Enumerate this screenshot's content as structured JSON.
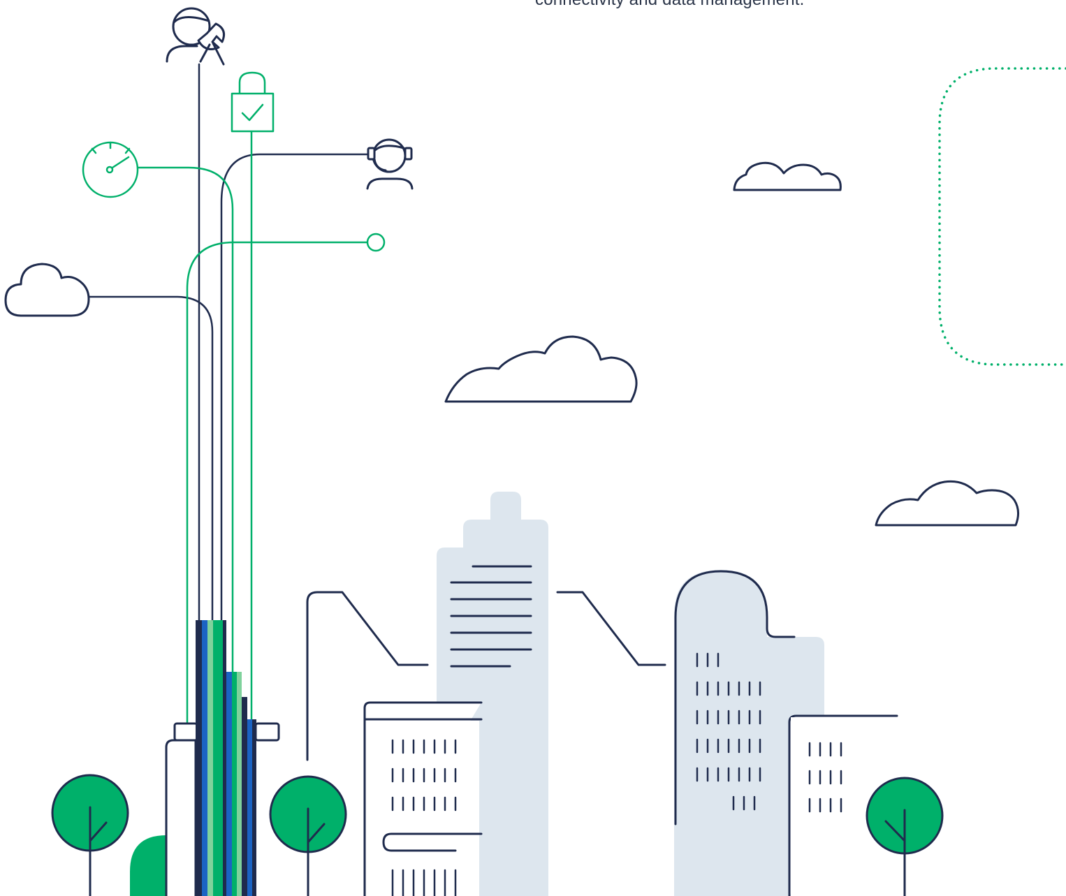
{
  "caption": {
    "text": "connectivity and data management."
  },
  "colors": {
    "navy": "#1f2b4d",
    "green": "#00b06a",
    "light_green": "#7fd29c",
    "blue": "#1b63c3",
    "light_blue": "#dde6ee",
    "text_gray": "#2a3448"
  },
  "icons": [
    "technician-wrench-icon",
    "padlock-check-icon",
    "speedometer-icon",
    "support-agent-headset-icon",
    "endpoint-circle-icon",
    "cloud-icon",
    "tree-icon",
    "data-center-tower-icon",
    "office-building-icon"
  ]
}
